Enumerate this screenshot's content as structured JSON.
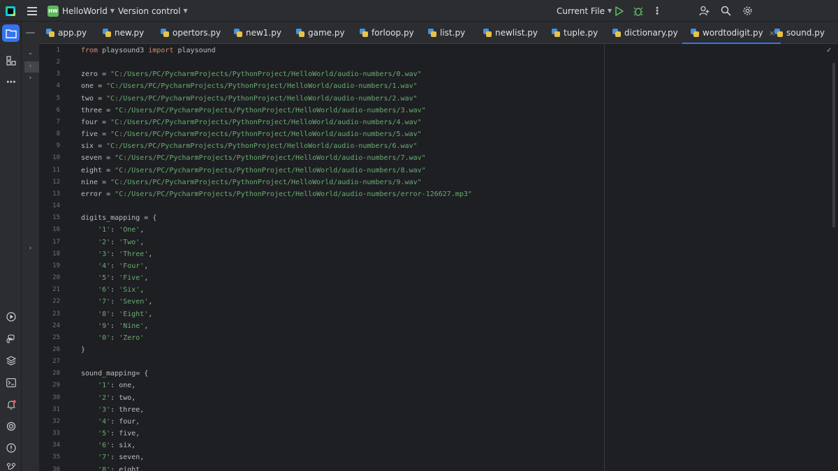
{
  "titlebar": {
    "project_badge": "HW",
    "project_name": "HelloWorld",
    "version_control": "Version control",
    "run_config": "Current File"
  },
  "icons": {
    "app_logo": "pycharm-logo-icon",
    "menu": "hamburger-icon",
    "run": "run-icon",
    "debug": "debug-icon",
    "more": "more-vertical-icon",
    "user": "add-user-icon",
    "search": "search-icon",
    "settings": "settings-icon"
  },
  "colors": {
    "accent": "#3574f0",
    "run_green": "#5fb865",
    "keyword": "#cf8e6d",
    "string": "#6aab73",
    "text": "#bcbec4"
  },
  "tabs": [
    {
      "label": "app.py"
    },
    {
      "label": "new.py"
    },
    {
      "label": "opertors.py"
    },
    {
      "label": "new1.py"
    },
    {
      "label": "game.py"
    },
    {
      "label": "forloop.py"
    },
    {
      "label": "list.py"
    },
    {
      "label": "newlist.py"
    },
    {
      "label": "tuple.py"
    },
    {
      "label": "dictionary.py"
    },
    {
      "label": "wordtodigit.py",
      "active": true,
      "close": "×"
    },
    {
      "label": "sound.py"
    }
  ],
  "editor": {
    "lines": [
      [
        {
          "t": "from",
          "c": "kw"
        },
        {
          "t": " playsound3 "
        },
        {
          "t": "import",
          "c": "kw"
        },
        {
          "t": " playsound"
        }
      ],
      [],
      [
        {
          "t": "zero = "
        },
        {
          "t": "\"C:/Users/PC/PycharmProjects/PythonProject/HelloWorld/audio-numbers/0.wav\"",
          "c": "str"
        }
      ],
      [
        {
          "t": "one = "
        },
        {
          "t": "\"C:/Users/PC/PycharmProjects/PythonProject/HelloWorld/audio-numbers/1.wav\"",
          "c": "str"
        }
      ],
      [
        {
          "t": "two = "
        },
        {
          "t": "\"C:/Users/PC/PycharmProjects/PythonProject/HelloWorld/audio-numbers/2.wav\"",
          "c": "str"
        }
      ],
      [
        {
          "t": "three = "
        },
        {
          "t": "\"C:/Users/PC/PycharmProjects/PythonProject/HelloWorld/audio-numbers/3.wav\"",
          "c": "str"
        }
      ],
      [
        {
          "t": "four = "
        },
        {
          "t": "\"C:/Users/PC/PycharmProjects/PythonProject/HelloWorld/audio-numbers/4.wav\"",
          "c": "str"
        }
      ],
      [
        {
          "t": "five = "
        },
        {
          "t": "\"C:/Users/PC/PycharmProjects/PythonProject/HelloWorld/audio-numbers/5.wav\"",
          "c": "str"
        }
      ],
      [
        {
          "t": "six = "
        },
        {
          "t": "\"C:/Users/PC/PycharmProjects/PythonProject/HelloWorld/audio-numbers/6.wav\"",
          "c": "str"
        }
      ],
      [
        {
          "t": "seven = "
        },
        {
          "t": "\"C:/Users/PC/PycharmProjects/PythonProject/HelloWorld/audio-numbers/7.wav\"",
          "c": "str"
        }
      ],
      [
        {
          "t": "eight = "
        },
        {
          "t": "\"C:/Users/PC/PycharmProjects/PythonProject/HelloWorld/audio-numbers/8.wav\"",
          "c": "str"
        }
      ],
      [
        {
          "t": "nine = "
        },
        {
          "t": "\"C:/Users/PC/PycharmProjects/PythonProject/HelloWorld/audio-numbers/9.wav\"",
          "c": "str"
        }
      ],
      [
        {
          "t": "error = "
        },
        {
          "t": "\"C:/Users/PC/PycharmProjects/PythonProject/HelloWorld/audio-numbers/error-126627.mp3\"",
          "c": "str"
        }
      ],
      [],
      [
        {
          "t": "digits_mapping = {"
        }
      ],
      [
        {
          "t": "    "
        },
        {
          "t": "'1'",
          "c": "str"
        },
        {
          "t": ": "
        },
        {
          "t": "'One'",
          "c": "str"
        },
        {
          "t": ","
        }
      ],
      [
        {
          "t": "    "
        },
        {
          "t": "'2'",
          "c": "str"
        },
        {
          "t": ": "
        },
        {
          "t": "'Two'",
          "c": "str"
        },
        {
          "t": ","
        }
      ],
      [
        {
          "t": "    "
        },
        {
          "t": "'3'",
          "c": "str"
        },
        {
          "t": ": "
        },
        {
          "t": "'Three'",
          "c": "str"
        },
        {
          "t": ","
        }
      ],
      [
        {
          "t": "    "
        },
        {
          "t": "'4'",
          "c": "str"
        },
        {
          "t": ": "
        },
        {
          "t": "'Four'",
          "c": "str"
        },
        {
          "t": ","
        }
      ],
      [
        {
          "t": "    "
        },
        {
          "t": "'5'",
          "c": "str"
        },
        {
          "t": ": "
        },
        {
          "t": "'Five'",
          "c": "str"
        },
        {
          "t": ","
        }
      ],
      [
        {
          "t": "    "
        },
        {
          "t": "'6'",
          "c": "str"
        },
        {
          "t": ": "
        },
        {
          "t": "'Six'",
          "c": "str"
        },
        {
          "t": ","
        }
      ],
      [
        {
          "t": "    "
        },
        {
          "t": "'7'",
          "c": "str"
        },
        {
          "t": ": "
        },
        {
          "t": "'Seven'",
          "c": "str"
        },
        {
          "t": ","
        }
      ],
      [
        {
          "t": "    "
        },
        {
          "t": "'8'",
          "c": "str"
        },
        {
          "t": ": "
        },
        {
          "t": "'Eight'",
          "c": "str"
        },
        {
          "t": ","
        }
      ],
      [
        {
          "t": "    "
        },
        {
          "t": "'9'",
          "c": "str"
        },
        {
          "t": ": "
        },
        {
          "t": "'Nine'",
          "c": "str"
        },
        {
          "t": ","
        }
      ],
      [
        {
          "t": "    "
        },
        {
          "t": "'0'",
          "c": "str"
        },
        {
          "t": ": "
        },
        {
          "t": "'Zero'",
          "c": "str"
        }
      ],
      [
        {
          "t": "}"
        }
      ],
      [],
      [
        {
          "t": "sound_mapping= {"
        }
      ],
      [
        {
          "t": "    "
        },
        {
          "t": "'1'",
          "c": "str"
        },
        {
          "t": ": one,"
        }
      ],
      [
        {
          "t": "    "
        },
        {
          "t": "'2'",
          "c": "str"
        },
        {
          "t": ": two,"
        }
      ],
      [
        {
          "t": "    "
        },
        {
          "t": "'3'",
          "c": "str"
        },
        {
          "t": ": three,"
        }
      ],
      [
        {
          "t": "    "
        },
        {
          "t": "'4'",
          "c": "str"
        },
        {
          "t": ": four,"
        }
      ],
      [
        {
          "t": "    "
        },
        {
          "t": "'5'",
          "c": "str"
        },
        {
          "t": ": five,"
        }
      ],
      [
        {
          "t": "    "
        },
        {
          "t": "'6'",
          "c": "str"
        },
        {
          "t": ": six,"
        }
      ],
      [
        {
          "t": "    "
        },
        {
          "t": "'7'",
          "c": "str"
        },
        {
          "t": ": seven,"
        }
      ],
      [
        {
          "t": "    "
        },
        {
          "t": "'8'",
          "c": "str"
        },
        {
          "t": ": eight,"
        }
      ]
    ]
  }
}
